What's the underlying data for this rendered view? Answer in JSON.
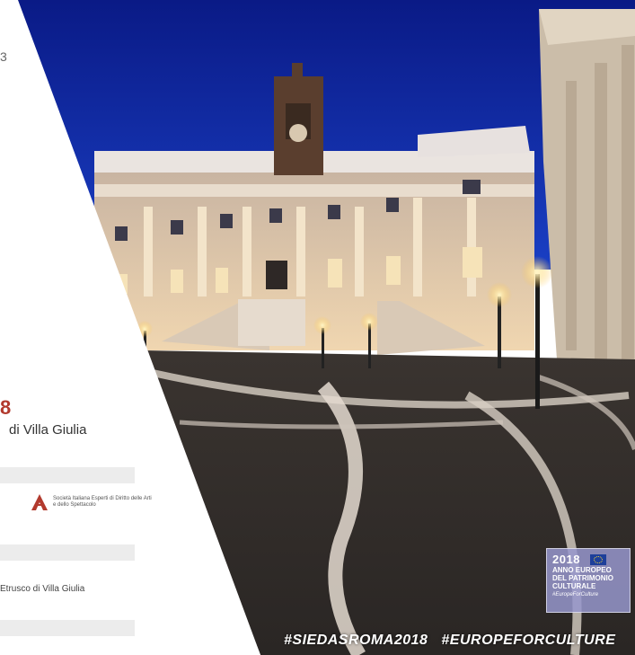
{
  "left_panel": {
    "top_fragment": "3",
    "year_fragment": "8",
    "villa_line": "di Villa Giulia",
    "sponsor_text": "Società Italiana Esperti di Diritto delle Arti e dello Spettacolo",
    "etrusco_line": "Etrusco di Villa Giulia"
  },
  "badge": {
    "year": "2018",
    "line1": "ANNO EUROPEO",
    "line2": "DEL PATRIMONIO",
    "line3": "CULTURALE",
    "tag": "#EuropeForCulture"
  },
  "hashtags": [
    "#SIEDASROMA2018",
    "#EUROPEFORCULTURE"
  ],
  "colors": {
    "accent": "#b23a2e",
    "sky": "#0b1f8f",
    "badge": "#9696cd"
  }
}
